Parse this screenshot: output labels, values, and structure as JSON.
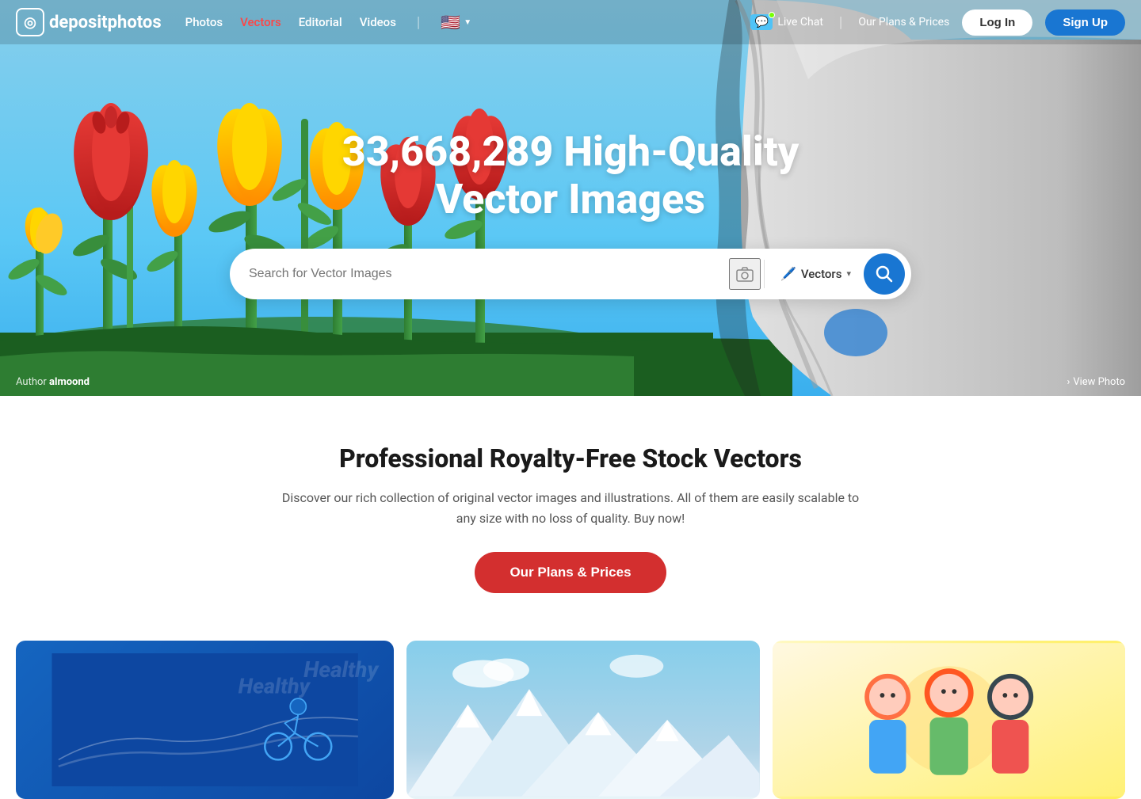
{
  "nav": {
    "logo_text": "depositphotos",
    "links": [
      {
        "label": "Photos",
        "active": false
      },
      {
        "label": "Vectors",
        "active": true
      },
      {
        "label": "Editorial",
        "active": false
      },
      {
        "label": "Videos",
        "active": false
      }
    ],
    "live_chat_label": "Live Chat",
    "plans_label": "Our Plans & Prices",
    "login_label": "Log In",
    "signup_label": "Sign Up"
  },
  "hero": {
    "title_line1": "33,668,289 High-Quality",
    "title_line2": "Vector Images",
    "search_placeholder": "Search for Vector Images",
    "search_type_label": "Vectors",
    "author_prefix": "Author",
    "author_name": "almoond",
    "view_photo_label": "View Photo"
  },
  "section": {
    "title": "Professional Royalty-Free Stock Vectors",
    "description": "Discover our rich collection of original vector images and illustrations. All of them are easily scalable to any size with no loss of quality. Buy now!",
    "cta_label": "Our Plans & Prices"
  },
  "colors": {
    "accent_blue": "#1976d2",
    "accent_red": "#d32f2f",
    "nav_active": "#ff4444"
  }
}
